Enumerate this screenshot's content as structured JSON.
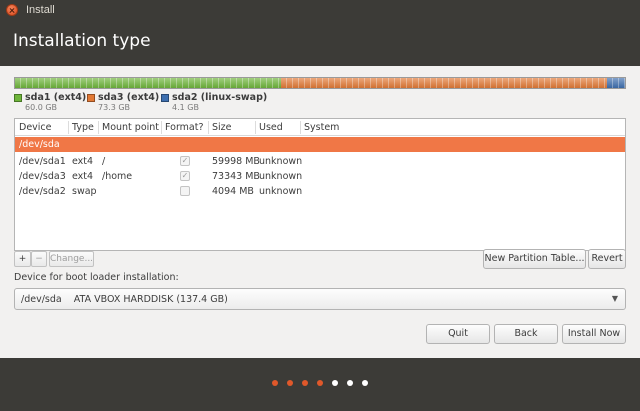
{
  "window": {
    "title": "Install"
  },
  "header": {
    "title": "Installation type"
  },
  "colors": {
    "ext4_sda1": "#6eb53a",
    "ext4_sda3": "#e27935",
    "swap": "#3e6faf",
    "selected_row": "#f07746",
    "progress_done": "#e0582a",
    "progress_todo": "#ffffff"
  },
  "partition_bar": [
    {
      "name": "sda1 (ext4)",
      "size": "60.0 GB",
      "color": "#6eb53a",
      "fraction": 0.4366
    },
    {
      "name": "sda3 (ext4)",
      "size": "73.3 GB",
      "color": "#e27935",
      "fraction": 0.5335
    },
    {
      "name": "sda2 (linux-swap)",
      "size": "4.1 GB",
      "color": "#3e6faf",
      "fraction": 0.0299
    }
  ],
  "table": {
    "headers": [
      "Device",
      "Type",
      "Mount point",
      "Format?",
      "Size",
      "Used",
      "System"
    ],
    "rows": [
      {
        "device": "/dev/sda",
        "type": "",
        "mount": "",
        "format": null,
        "size": "",
        "used": "",
        "system": "",
        "selected": true
      },
      {
        "device": "/dev/sda1",
        "type": "ext4",
        "mount": "/",
        "format": true,
        "size": "59998 MB",
        "used": "unknown",
        "system": ""
      },
      {
        "device": "/dev/sda3",
        "type": "ext4",
        "mount": "/home",
        "format": true,
        "size": "73343 MB",
        "used": "unknown",
        "system": ""
      },
      {
        "device": "/dev/sda2",
        "type": "swap",
        "mount": "",
        "format": false,
        "size": "4094 MB",
        "used": "unknown",
        "system": ""
      }
    ]
  },
  "table_toolbar": {
    "add_label": "+",
    "remove_label": "−",
    "change_label": "Change...",
    "new_table_label": "New Partition Table...",
    "revert_label": "Revert"
  },
  "bootloader": {
    "label": "Device for boot loader installation:",
    "value": "/dev/sda    ATA VBOX HARDDISK (137.4 GB)"
  },
  "buttons": {
    "quit": "Quit",
    "back": "Back",
    "install_now": "Install Now"
  },
  "progress": {
    "total_steps": 7,
    "completed_steps": 4
  }
}
